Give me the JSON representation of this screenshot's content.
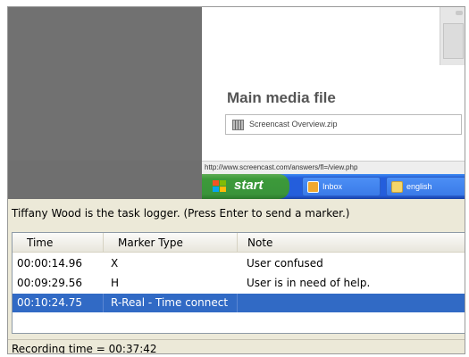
{
  "preview": {
    "media_title": "Main media file",
    "file_name": "Screencast Overview.zip",
    "status_url": "http://www.screencast.com/answers/fl=/view.php",
    "taskbar": {
      "start_label": "start",
      "buttons": [
        {
          "label": "Inbox",
          "icon": "mail-icon"
        },
        {
          "label": "english",
          "icon": "folder-icon"
        }
      ]
    }
  },
  "logger": {
    "info_text": "Tiffany Wood is the task logger.  (Press Enter to send a marker.)",
    "columns": [
      "Time",
      "Marker Type",
      "Note"
    ],
    "rows": [
      {
        "time": "00:00:14.96",
        "marker": "X",
        "note": "User confused"
      },
      {
        "time": "00:09:29.56",
        "marker": "H",
        "note": "User is in need of help."
      },
      {
        "time": "00:10:24.75",
        "marker": "R-Real - Time connect",
        "note": ""
      }
    ],
    "selected_row": 2,
    "status_text": "Recording time = 00:37:42"
  },
  "colors": {
    "selection": "#316ac5",
    "taskbar": "#245edc",
    "start_button": "#3c9a3a",
    "panel": "#ece9d8"
  }
}
